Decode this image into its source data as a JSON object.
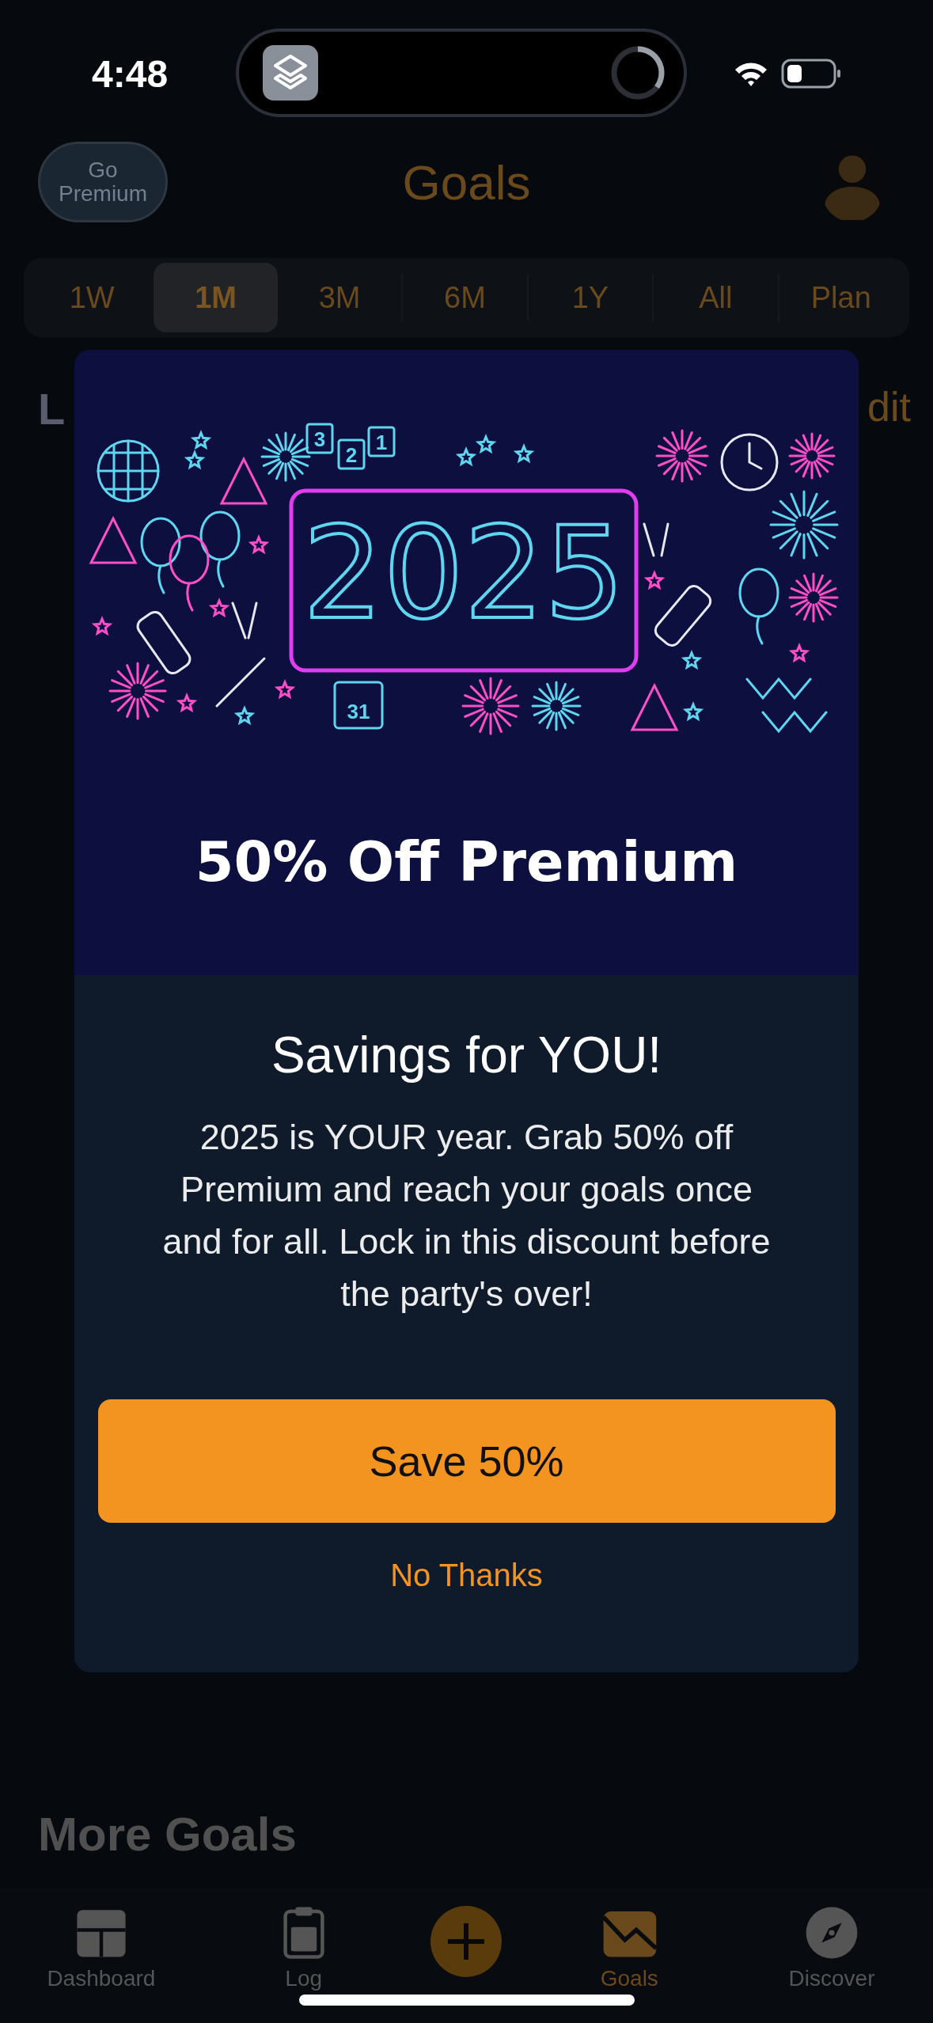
{
  "status_bar": {
    "time": "4:48"
  },
  "header": {
    "premium_button": "Go Premium",
    "title": "Goals"
  },
  "range_tabs": [
    {
      "label": "1W",
      "selected": false
    },
    {
      "label": "1M",
      "selected": true
    },
    {
      "label": "3M",
      "selected": false
    },
    {
      "label": "6M",
      "selected": false
    },
    {
      "label": "1Y",
      "selected": false
    },
    {
      "label": "All",
      "selected": false
    },
    {
      "label": "Plan",
      "selected": false
    }
  ],
  "section_behind": {
    "left_heading": "L",
    "right_link": "dit"
  },
  "more_goals_heading": "More Goals",
  "modal": {
    "illustration": {
      "year": "2025",
      "countdown": [
        "3",
        "2",
        "1"
      ],
      "calendar_day": "31"
    },
    "banner_title": "50% Off Premium",
    "heading": "Savings for YOU!",
    "body": "2025 is YOUR year. Grab 50% off Premium and reach your goals once and for all. Lock in this discount before the party's over!",
    "primary_button": "Save 50%",
    "secondary_button": "No Thanks"
  },
  "tab_bar": [
    {
      "label": "Dashboard",
      "selected": false
    },
    {
      "label": "Log",
      "selected": false
    },
    {
      "label": "Goals",
      "selected": true
    },
    {
      "label": "Discover",
      "selected": false
    }
  ]
}
